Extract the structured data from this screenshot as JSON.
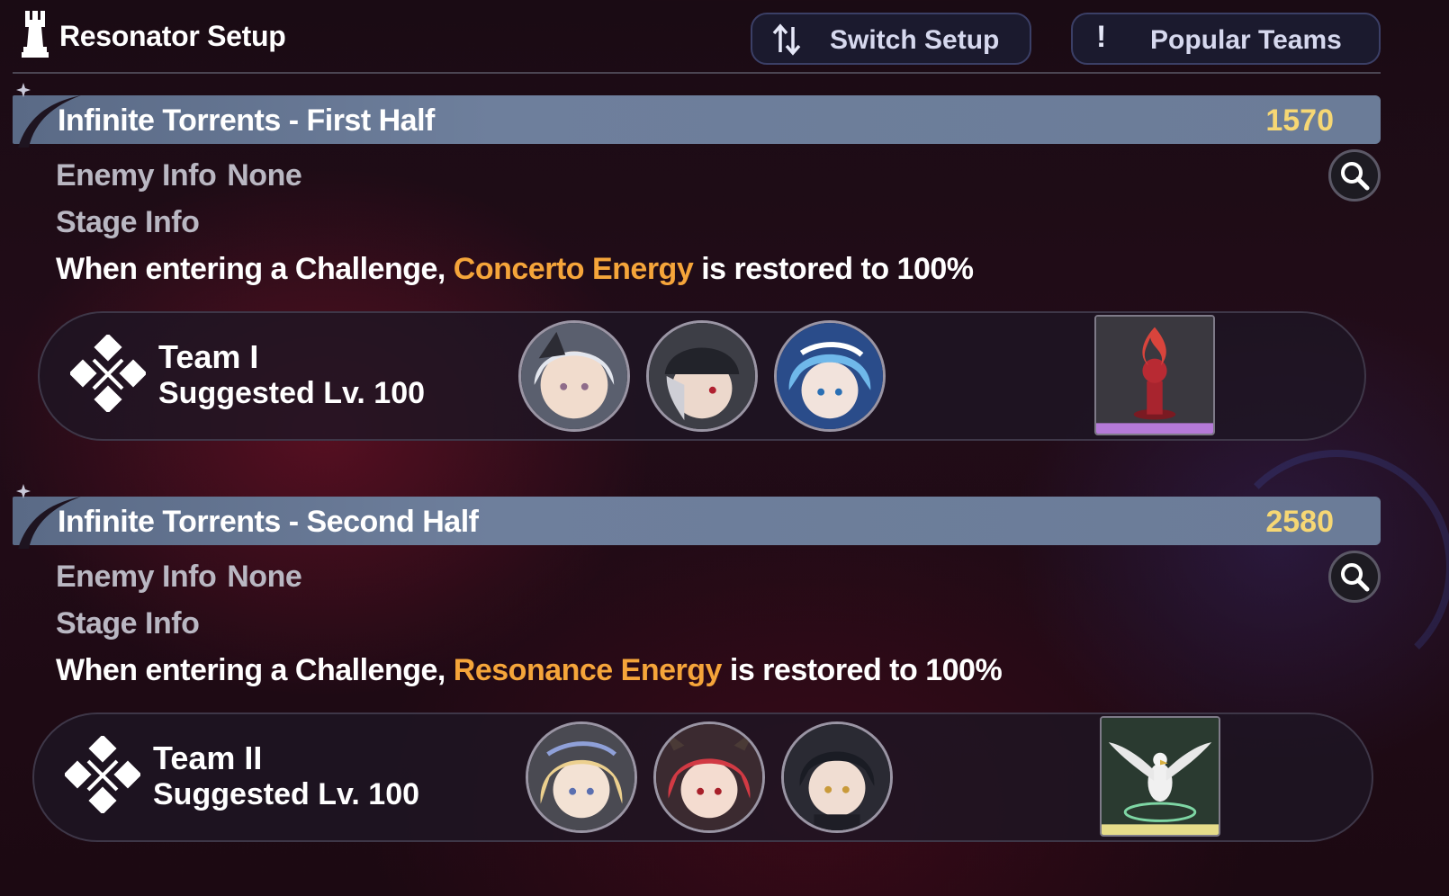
{
  "header": {
    "title": "Resonator Setup",
    "title_icon": "chess-rook-icon",
    "switch_setup_label": "Switch Setup",
    "switch_icon": "swap-arrows-icon",
    "popular_teams_label": "Popular Teams",
    "popular_icon": "exclamation-icon"
  },
  "sections": [
    {
      "title": "Infinite Torrents - First Half",
      "score": "1570",
      "enemy_info_label": "Enemy Info",
      "enemy_info_value": "None",
      "stage_info_label": "Stage Info",
      "desc_prefix": "When entering a Challenge,",
      "desc_highlight": "Concerto Energy",
      "desc_suffix": "is restored to 100%",
      "team": {
        "name": "Team I",
        "level": "Suggested Lv. 100",
        "icon": "crossed-swords-icon",
        "resonators": [
          "silver-haired-resonator-avatar",
          "capped-resonator-avatar",
          "blue-haired-resonator-avatar"
        ],
        "echo": "red-flame-chess-echo-icon"
      }
    },
    {
      "title": "Infinite Torrents - Second Half",
      "score": "2580",
      "enemy_info_label": "Enemy Info",
      "enemy_info_value": "None",
      "stage_info_label": "Stage Info",
      "desc_prefix": "When entering a Challenge,",
      "desc_highlight": "Resonance Energy",
      "desc_suffix": "is restored to 100%",
      "team": {
        "name": "Team II",
        "level": "Suggested Lv. 100",
        "icon": "crossed-swords-icon",
        "resonators": [
          "blonde-crowned-resonator-avatar",
          "red-haired-horned-resonator-avatar",
          "dark-haired-resonator-avatar"
        ],
        "echo": "white-eagle-echo-icon"
      }
    }
  ],
  "colors": {
    "score": "#f6d774",
    "highlight": "#f5a53a",
    "bar": "#6b7c98",
    "button_border": "#3b3f66"
  }
}
